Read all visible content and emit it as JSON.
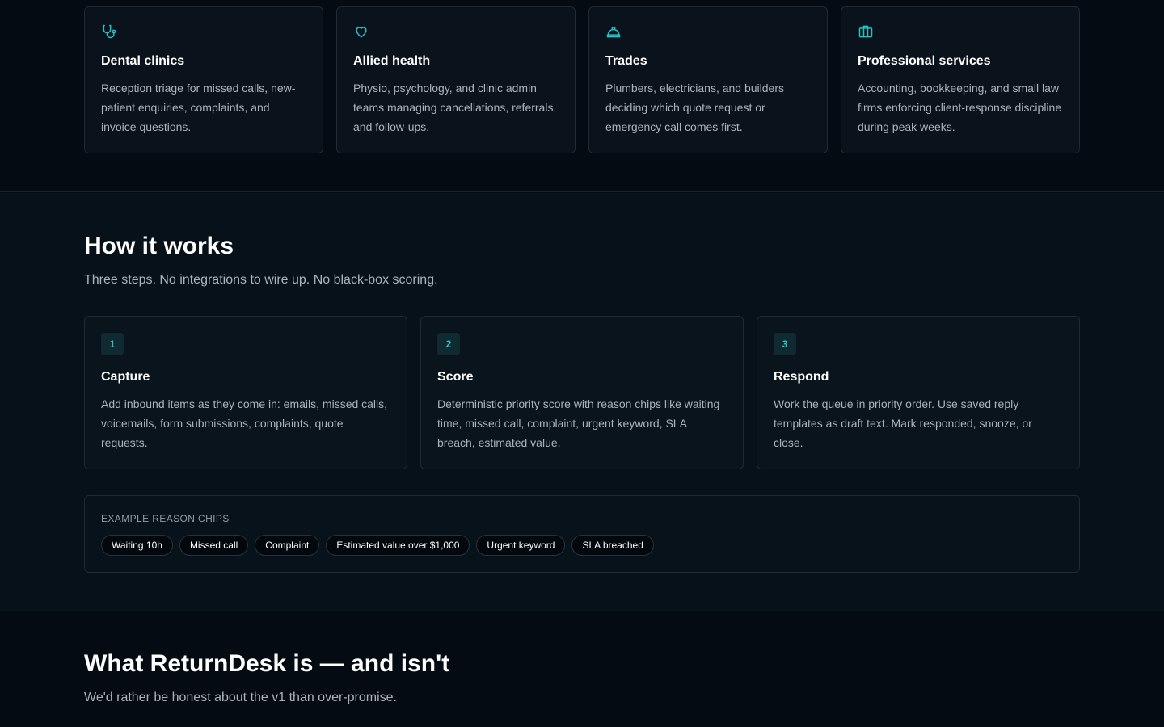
{
  "industries": [
    {
      "icon": "stethoscope-icon",
      "title": "Dental clinics",
      "description": "Reception triage for missed calls, new-patient enquiries, complaints, and invoice questions."
    },
    {
      "icon": "heart-icon",
      "title": "Allied health",
      "description": "Physio, psychology, and clinic admin teams managing cancellations, referrals, and follow-ups."
    },
    {
      "icon": "hard-hat-icon",
      "title": "Trades",
      "description": "Plumbers, electricians, and builders deciding which quote request or emergency call comes first."
    },
    {
      "icon": "briefcase-icon",
      "title": "Professional services",
      "description": "Accounting, bookkeeping, and small law firms enforcing client-response discipline during peak weeks."
    }
  ],
  "how_it_works": {
    "title": "How it works",
    "subtitle": "Three steps. No integrations to wire up. No black-box scoring.",
    "steps": [
      {
        "number": "1",
        "title": "Capture",
        "description": "Add inbound items as they come in: emails, missed calls, voicemails, form submissions, complaints, quote requests."
      },
      {
        "number": "2",
        "title": "Score",
        "description": "Deterministic priority score with reason chips like waiting time, missed call, complaint, urgent keyword, SLA breach, estimated value."
      },
      {
        "number": "3",
        "title": "Respond",
        "description": "Work the queue in priority order. Use saved reply templates as draft text. Mark responded, snooze, or close."
      }
    ],
    "chips_label": "EXAMPLE REASON CHIPS",
    "chips": [
      "Waiting 10h",
      "Missed call",
      "Complaint",
      "Estimated value over $1,000",
      "Urgent keyword",
      "SLA breached"
    ]
  },
  "honest": {
    "title": "What ReturnDesk is — and isn't",
    "subtitle": "We'd rather be honest about the v1 than over-promise."
  },
  "colors": {
    "accent": "#22c3c9",
    "background": "#050b12",
    "card": "#0a131b"
  }
}
